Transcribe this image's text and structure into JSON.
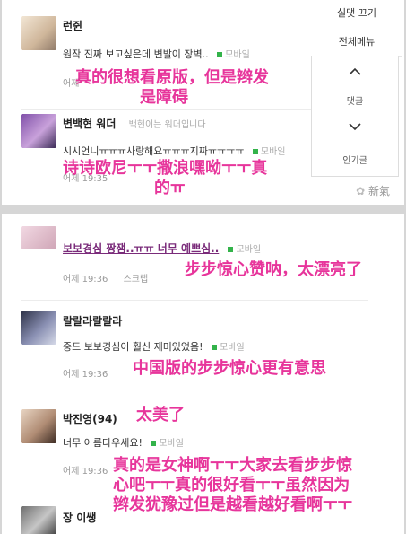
{
  "panel1": {
    "comments": [
      {
        "author": "런쥔",
        "text": "원작 진짜 보고싶은데 변발이 장벽..",
        "mobile": "모바일",
        "time": "어제",
        "translation": [
          "真的很想看原版，但是辫发",
          "是障碍"
        ]
      },
      {
        "author": "변백현 워더",
        "intro": "백현이는 워더입니다",
        "text": "시시언니ㅠㅠㅠ사랑해요ㅠㅠㅠ지짜ㅠㅠㅠㅠ",
        "mobile": "모바일",
        "time": "어제 19:35",
        "translation": [
          "诗诗欧尼ㅜㅜ撒浪嘿呦ㅜㅜ真",
          "的ㅠ"
        ]
      }
    ],
    "side_menu": {
      "top_items": [
        "실댓 끄기",
        "전체메뉴"
      ],
      "up_icon": "chevron-up-icon",
      "comments_label": "댓글",
      "down_icon": "chevron-down-icon",
      "popular_label": "인기글"
    },
    "watermark": "新氣"
  },
  "panel2": {
    "comments": [
      {
        "author": "보보경심 짱잼..ㅠㅠ 너무 예쁘심..",
        "mobile": "모바일",
        "time": "어제 19:36",
        "scrap": "스크랩",
        "translation": [
          "步步惊心赞呐，太漂亮了"
        ]
      },
      {
        "author": "랄랄라랄랄라",
        "text": "중드 보보경심이 훨신 재미있었음!",
        "mobile": "모바일",
        "time": "어제 19:36",
        "translation": [
          "中国版的步步惊心更有意思"
        ]
      },
      {
        "author": "박진영(94)",
        "text": "너무 아름다우세요!",
        "mobile": "모바일",
        "time": "어제 19:36",
        "translation_short": "太美了",
        "translation": [
          "真的是女神啊ㅜㅜ大家去看步步惊",
          "心吧ㅜㅜ真的很好看ㅜㅜ虽然因为",
          "辫发犹豫过但是越看越好看啊ㅜㅜ"
        ]
      },
      {
        "author": "장 이쌩"
      }
    ]
  },
  "colors": {
    "annotation": "#e7359b",
    "mobile_dot": "#33b34a",
    "background": "#d6d6d6"
  }
}
